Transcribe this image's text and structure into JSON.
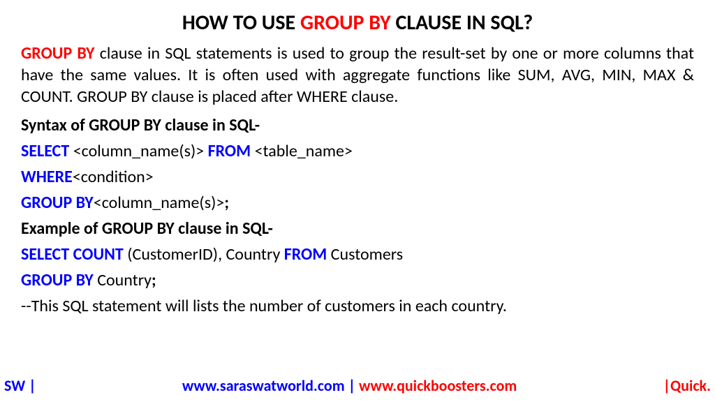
{
  "title": {
    "part1": "HOW TO USE ",
    "highlight": "GROUP BY",
    "part2": " CLAUSE IN SQL?"
  },
  "description": {
    "highlight": "GROUP BY",
    "text": " clause in SQL statements is used to group the result-set by one or more columns that have the same values. It is often used with aggregate functions like SUM, AVG, MIN, MAX & COUNT. GROUP BY clause is placed after WHERE clause."
  },
  "syntaxHeading": "Syntax of GROUP BY clause in SQL-",
  "syntax": {
    "line1": {
      "kw1": "SELECT",
      "txt1": " <column_name(s)> ",
      "kw2": "FROM",
      "txt2": " <table_name>"
    },
    "line2": {
      "kw1": "WHERE",
      "txt1": "<condition>"
    },
    "line3": {
      "kw1": "GROUP BY",
      "txt1": "<column_name(s)>",
      "semi": ";"
    }
  },
  "exampleHeading": "Example of GROUP BY clause in SQL-",
  "example": {
    "line1": {
      "kw1": "SELECT COUNT",
      "txt1": " (CustomerID), Country ",
      "kw2": "FROM",
      "txt2": " Customers"
    },
    "line2": {
      "kw1": "GROUP BY",
      "txt1": " Country",
      "semi": ";"
    }
  },
  "comment": "--This SQL statement will lists the number of customers in each country.",
  "footer": {
    "left": "SW |",
    "centerBlue": "www.saraswatworld.com | ",
    "centerRed": "www.quickboosters.com",
    "right": "|Quick."
  }
}
